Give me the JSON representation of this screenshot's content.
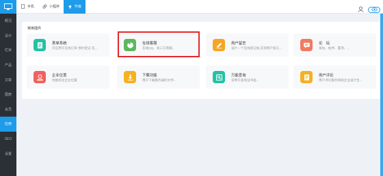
{
  "sidebar": {
    "items": [
      {
        "label": "概况"
      },
      {
        "label": "设计"
      },
      {
        "label": "栏目"
      },
      {
        "label": "产品"
      },
      {
        "label": "文章"
      },
      {
        "label": "图册"
      },
      {
        "label": "会员"
      },
      {
        "label": "应用"
      },
      {
        "label": "SEO"
      },
      {
        "label": "设置"
      }
    ],
    "active_index": 7
  },
  "topbar": {
    "tabs": [
      {
        "label": "手机",
        "icon": "phone-icon"
      },
      {
        "label": "小程序",
        "icon": "miniprogram-icon"
      },
      {
        "label": "升级",
        "icon": "upgrade-icon"
      }
    ]
  },
  "main": {
    "section_title": "常用插件",
    "cards": [
      {
        "name": "表单系统",
        "desc": "可应用于在线订单·预约登记·在...",
        "icon": "form-icon",
        "color": "#22c3a5"
      },
      {
        "name": "在线客服",
        "desc": "在线QQ、第三方客服...",
        "icon": "chat-icon",
        "color": "#5cb85c"
      },
      {
        "name": "用户留言",
        "desc": "设计一个在线留言板,实现用户留言...",
        "icon": "pen-icon",
        "color": "#f5a623"
      },
      {
        "name": "论　坛",
        "desc": "发帖、帖伴、置顶、...",
        "icon": "forum-icon",
        "color": "#f27a5e"
      },
      {
        "name": "企业位置",
        "desc": "地图标注企业位置",
        "icon": "location-icon",
        "color": "#f0625e"
      },
      {
        "name": "下载功能",
        "desc": "用于下载服务器的文件...",
        "icon": "download-icon",
        "color": "#f5b123"
      },
      {
        "name": "万能查询",
        "desc": "常用于查询证书查...",
        "icon": "query-icon",
        "color": "#22c3a5"
      },
      {
        "name": "用户评论",
        "desc": "用户评论服务帮助企业设计生...",
        "icon": "comment-icon",
        "color": "#f5b123"
      }
    ]
  }
}
